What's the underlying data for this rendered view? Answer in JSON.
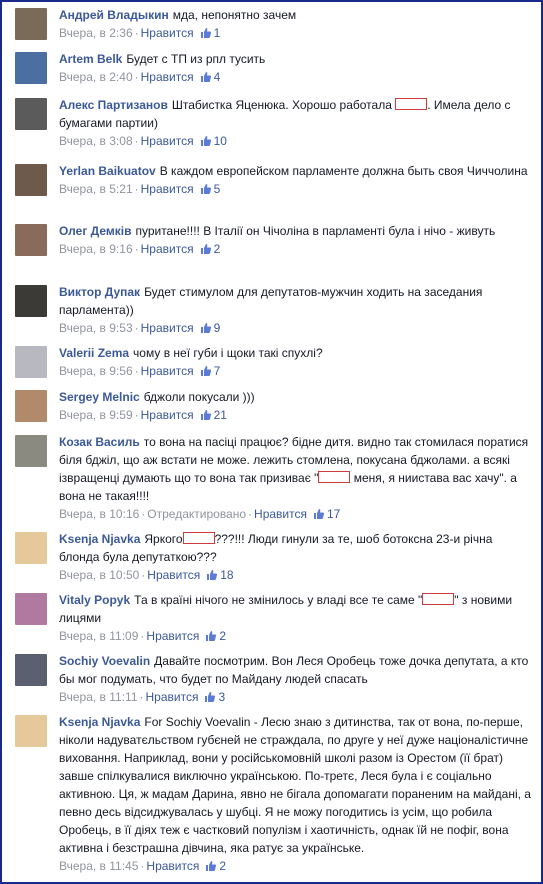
{
  "comments": [
    {
      "author": "Андрей Владыкин",
      "pre": "мда, непонятно зачем",
      "redacted": false,
      "post": "",
      "time": "Вчера, в 2:36",
      "like": "Нравится",
      "likes": "1",
      "avatar_color": "#7a6a58"
    },
    {
      "author": "Artem Belk",
      "pre": "Будет с ТП из рпл тусить",
      "redacted": false,
      "post": "",
      "time": "Вчера, в 2:40",
      "like": "Нравится",
      "likes": "4",
      "avatar_color": "#4a6fa0"
    },
    {
      "author": "Алекс Партизанов",
      "pre": "Штабистка Яценюка. Хорошо работала",
      "redacted": true,
      "post": ". Имела дело с бумагами партии)",
      "time": "Вчера, в 3:08",
      "like": "Нравится",
      "likes": "10",
      "avatar_color": "#5b5b5b"
    },
    {
      "author": "Yerlan Baikuatov",
      "pre": "В каждом европейском парламенте должна быть своя Чиччолина",
      "redacted": false,
      "post": "",
      "time": "Вчера, в 5:21",
      "like": "Нравится",
      "likes": "5",
      "avatar_color": "#6d5a4a"
    },
    {
      "author": "Олег Демків",
      "pre": "пуритане!!!! В Італії он Чічоліна в парламенті була і нічо - живуть",
      "redacted": false,
      "post": "",
      "time": "Вчера, в 9:16",
      "like": "Нравится",
      "likes": "2",
      "avatar_color": "#8a6a5a"
    },
    {
      "author": "Виктор Дупак",
      "pre": "Будет стимулом для депутатов-мужчин ходить на заседания парламента))",
      "redacted": false,
      "post": "",
      "time": "Вчера, в 9:53",
      "like": "Нравится",
      "likes": "9",
      "avatar_color": "#3c3a36"
    },
    {
      "author": "Valerii Zema",
      "pre": "чому в неї губи і щоки такі спухлі?",
      "redacted": false,
      "post": "",
      "time": "Вчера, в 9:56",
      "like": "Нравится",
      "likes": "7",
      "avatar_color": "#b8b8c0"
    },
    {
      "author": "Sergey Melnic",
      "pre": "бджоли покусали )))",
      "redacted": false,
      "post": "",
      "time": "Вчера, в 9:59",
      "like": "Нравится",
      "likes": "21",
      "avatar_color": "#b08a6a"
    },
    {
      "author": "Козак Василь",
      "pre": "то вона на пасіці працює? бідне дитя. видно так стомилася поратися біля бджіл, що аж встати не може. лежить стомлена, покусана бджолами. а всякі ізвращенці думають що то вона так призиває \"",
      "redacted": true,
      "post": " меня, я ниистава вас хачу\". а вона не такая!!!!",
      "time": "Вчера, в 10:16",
      "edited": "Отредактировано",
      "like": "Нравится",
      "likes": "17",
      "avatar_color": "#8a8a80"
    },
    {
      "author": "Ksenja Njavka",
      "pre": "Яркого",
      "redacted": true,
      "post": "???!!! Люди гинули за те, шоб ботоксна 23-и річна блонда була депутаткою???",
      "time": "Вчера, в 10:50",
      "like": "Нравится",
      "likes": "18",
      "avatar_color": "#e6c99a"
    },
    {
      "author": "Vitaly Popyk",
      "pre": "Та в країні нічого не змінилось у владі все те саме \"",
      "redacted": true,
      "post": "\" з новими лицями",
      "time": "Вчера, в 11:09",
      "like": "Нравится",
      "likes": "2",
      "avatar_color": "#b07aa0"
    },
    {
      "author": "Sochiy Voevalin",
      "pre": "Давайте посмотрим. Вон Леся Оробець тоже дочка депутата, а кто бы мог подумать, что будет по Майдану людей спасать",
      "redacted": false,
      "post": "",
      "time": "Вчера, в 11:11",
      "like": "Нравится",
      "likes": "3",
      "avatar_color": "#5a6070"
    },
    {
      "author": "Ksenja Njavka",
      "pre": "For Sochiy Voevalin - Лесю знаю з дитинства, так от вона, по-перше, ніколи надуватєльством губєней не страждала, по друге у неї дуже націоналістичне виховання. Наприклад, вони у російськомовній школі разом із Орестом (її брат) завше спілкувалися виключно українською. По-третє, Леся була і є соціально активною. Ця, ж мадам Дарина, явно не бігала допомагати пораненим на майдані, а певно десь відсиджувалась у шубці. Я не можу погодитись із усім, що робила Оробець, в її діях теж є частковий популізм і хаотичність, однак їй не пофіг, вона активна і безстрашна дівчина, яка ратує за українське.",
      "redacted": false,
      "post": "",
      "time": "Вчера, в 11:45",
      "like": "Нравится",
      "likes": "2",
      "avatar_color": "#e6c99a"
    }
  ]
}
